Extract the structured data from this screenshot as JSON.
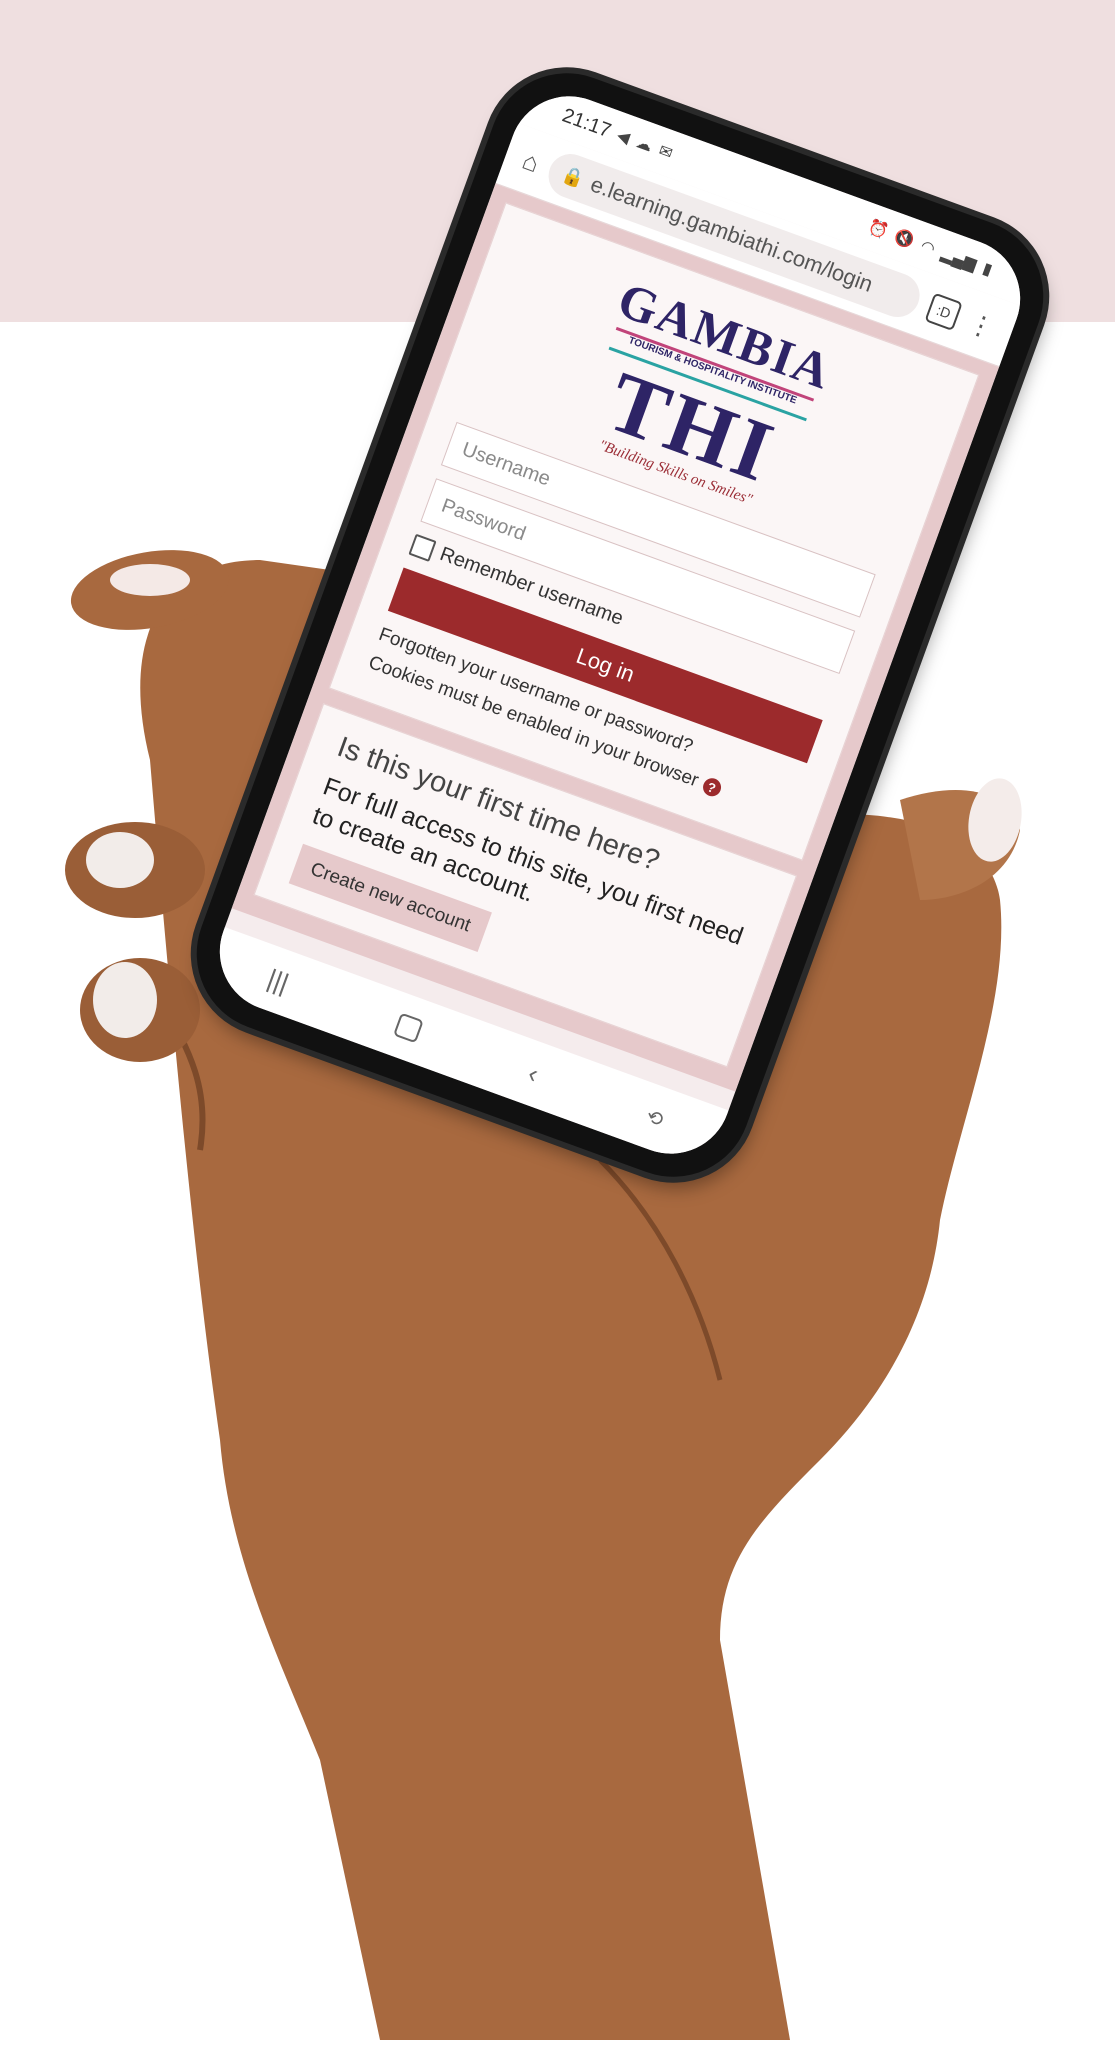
{
  "status_bar": {
    "time": "21:17"
  },
  "browser": {
    "url": "e.learning.gambiathi.com/login",
    "tabs_label": ":D"
  },
  "logo": {
    "top": "GAMBIA",
    "band": "TOURISM & HOSPITALITY INSTITUTE",
    "main": "THI",
    "tagline": "\"Building Skills on Smiles\""
  },
  "login": {
    "username_placeholder": "Username",
    "password_placeholder": "Password",
    "remember_label": "Remember username",
    "login_button": "Log in",
    "forgot_link": "Forgotten your username or password?",
    "cookies_note": "Cookies must be enabled in your browser"
  },
  "signup": {
    "heading": "Is this your first time here?",
    "description": "For full access to this site, you first need to create an account.",
    "create_button": "Create new account"
  },
  "colors": {
    "page_band": "#efdfe0",
    "accent": "#9c2a2c",
    "logo_navy": "#2e2466"
  }
}
